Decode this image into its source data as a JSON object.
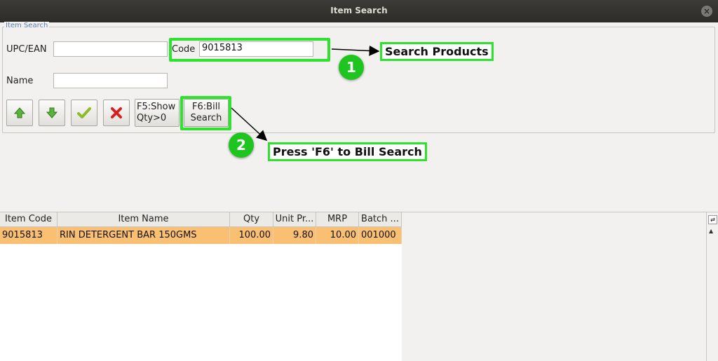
{
  "window": {
    "title": "Item Search"
  },
  "search": {
    "group_label": "Item Search",
    "upc_label": "UPC/EAN",
    "upc_value": "",
    "code_label": "Code",
    "code_value": "9015813",
    "name_label": "Name",
    "name_value": ""
  },
  "toolbar": {
    "up_icon": "up-arrow-icon",
    "down_icon": "down-arrow-icon",
    "ok_icon": "checkmark-icon",
    "cancel_icon": "red-x-icon",
    "show_qty_label_1": "F5:Show",
    "show_qty_label_2": "Qty>0",
    "bill_search_label_1": "F6:Bill",
    "bill_search_label_2": "Search"
  },
  "annotations": {
    "step1_number": "1",
    "step1_text": "Search Products",
    "step2_number": "2",
    "step2_text": "Press 'F6' to Bill Search",
    "highlight_color": "#2ee32e"
  },
  "table": {
    "headers": [
      "Item Code",
      "Item Name",
      "Qty",
      "Unit Pr...",
      "MRP",
      "Batch ..."
    ],
    "rows": [
      [
        "9015813",
        "RIN DETERGENT BAR 150GMS",
        "100.00",
        "9.80",
        "10.00",
        "001000"
      ]
    ],
    "selected_row_color": "#f9bf73"
  }
}
